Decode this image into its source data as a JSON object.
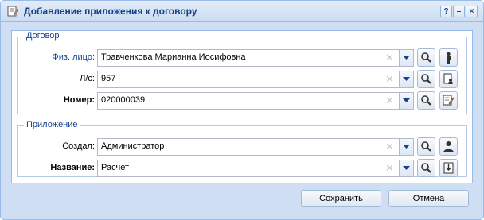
{
  "window": {
    "title": "Добавление приложения к договору"
  },
  "titlebar_buttons": [
    {
      "icon": "help-icon",
      "glyph": "?"
    },
    {
      "icon": "minimize-icon",
      "glyph": "–"
    },
    {
      "icon": "close-icon",
      "glyph": "×"
    }
  ],
  "contract": {
    "legend": "Договор",
    "person": {
      "label": "Физ. лицо:",
      "value": "Травченкова Марианна Иосифовна"
    },
    "account": {
      "label": "Л/с:",
      "value": "957"
    },
    "number": {
      "label": "Номер:",
      "value": "020000039"
    }
  },
  "attachment": {
    "legend": "Приложение",
    "created_by": {
      "label": "Создал:",
      "value": "Администратор"
    },
    "name": {
      "label": "Название:",
      "value": "Расчет"
    }
  },
  "footer": {
    "save_label": "Сохранить",
    "cancel_label": "Отмена"
  },
  "colors": {
    "title_text": "#15428b",
    "border": "#99bbe8",
    "frame_bg": "#cfdef3"
  }
}
